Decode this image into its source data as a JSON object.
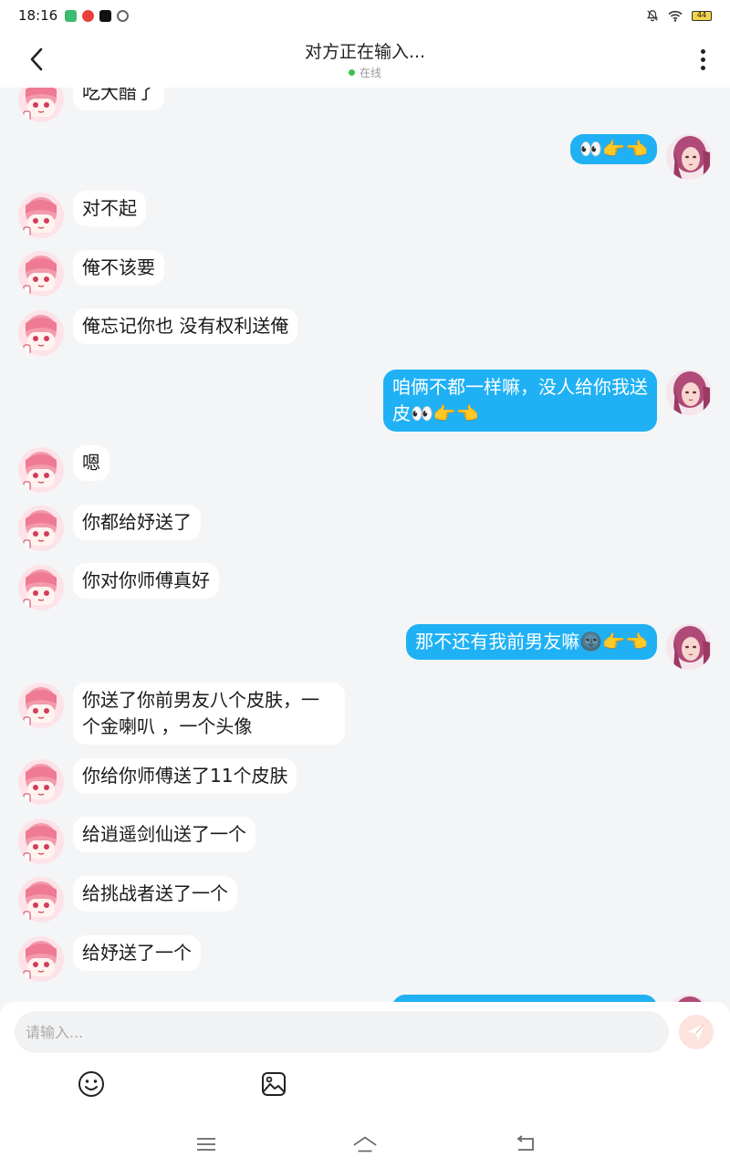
{
  "status_bar": {
    "time": "18:16",
    "battery": "44",
    "app_icons": [
      "app-badge-icon",
      "red-app-icon",
      "tiktok-icon",
      "sync-icon"
    ],
    "right_icons": [
      "bell-off-icon",
      "wifi-icon",
      "battery-icon"
    ]
  },
  "header": {
    "title": "对方正在输入...",
    "status": "在线",
    "status_color": "#3cc24a"
  },
  "colors": {
    "outgoing_bubble": "#1fb1f4",
    "incoming_bubble": "#ffffff",
    "background": "#f4f5f7"
  },
  "messages": [
    {
      "side": "in",
      "text": "吃大醋了"
    },
    {
      "side": "out",
      "text": "👀👉👈"
    },
    {
      "side": "in",
      "text": "对不起"
    },
    {
      "side": "in",
      "text": "俺不该要"
    },
    {
      "side": "in",
      "text": "俺忘记你也 没有权利送俺"
    },
    {
      "side": "out",
      "text": "咱俩不都一样嘛，没人给你我送皮👀👉👈"
    },
    {
      "side": "in",
      "text": "嗯"
    },
    {
      "side": "in",
      "text": "你都给妤送了"
    },
    {
      "side": "in",
      "text": "你对你师傅真好"
    },
    {
      "side": "out",
      "text": "那不还有我前男友嘛🌚👉👈"
    },
    {
      "side": "in",
      "text": "你送了你前男友八个皮肤，一个金喇叭 ，一个头像"
    },
    {
      "side": "in",
      "text": "你给你师傅送了11个皮肤"
    },
    {
      "side": "in",
      "text": "给逍遥剑仙送了一个"
    },
    {
      "side": "in",
      "text": "给挑战者送了一个"
    },
    {
      "side": "in",
      "text": "给妤送了一个"
    },
    {
      "side": "out",
      "text": ""
    }
  ],
  "composer": {
    "placeholder": "请输入...",
    "send_icon": "send-icon",
    "tools": [
      "emoji-icon",
      "image-icon"
    ]
  },
  "nav": {
    "icons": [
      "menu-icon",
      "home-icon",
      "back-nav-icon"
    ]
  }
}
